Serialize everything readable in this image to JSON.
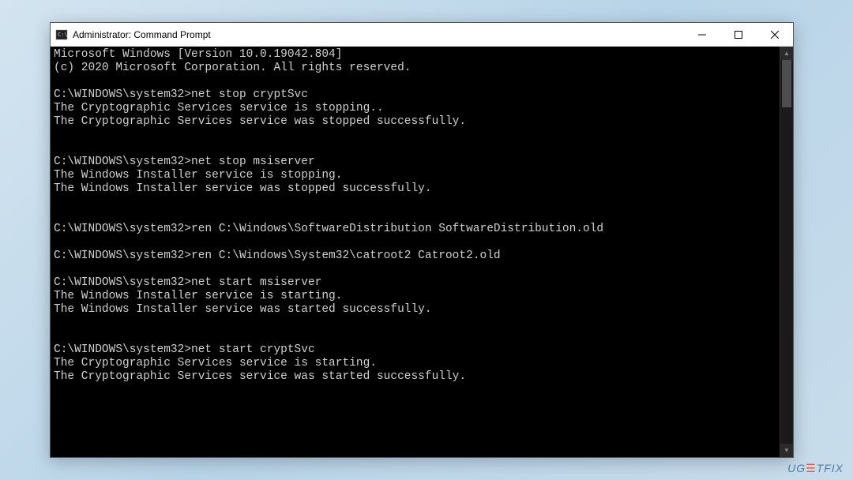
{
  "window": {
    "title": "Administrator: Command Prompt"
  },
  "console": {
    "header_line1": "Microsoft Windows [Version 10.0.19042.804]",
    "header_line2": "(c) 2020 Microsoft Corporation. All rights reserved.",
    "prompt": "C:\\WINDOWS\\system32>",
    "blocks": [
      {
        "cmd": "net stop cryptSvc",
        "out": [
          "The Cryptographic Services service is stopping..",
          "The Cryptographic Services service was stopped successfully."
        ]
      },
      {
        "cmd": "net stop msiserver",
        "out": [
          "The Windows Installer service is stopping.",
          "The Windows Installer service was stopped successfully."
        ]
      },
      {
        "cmd": "ren C:\\Windows\\SoftwareDistribution SoftwareDistribution.old",
        "out": []
      },
      {
        "cmd": "ren C:\\Windows\\System32\\catroot2 Catroot2.old",
        "out": []
      },
      {
        "cmd": "net start msiserver",
        "out": [
          "The Windows Installer service is starting.",
          "The Windows Installer service was started successfully."
        ]
      },
      {
        "cmd": "net start cryptSvc",
        "out": [
          "The Cryptographic Services service is starting.",
          "The Cryptographic Services service was started successfully."
        ]
      }
    ]
  },
  "watermark": {
    "text_before": "UG",
    "text_after": "TFIX"
  }
}
